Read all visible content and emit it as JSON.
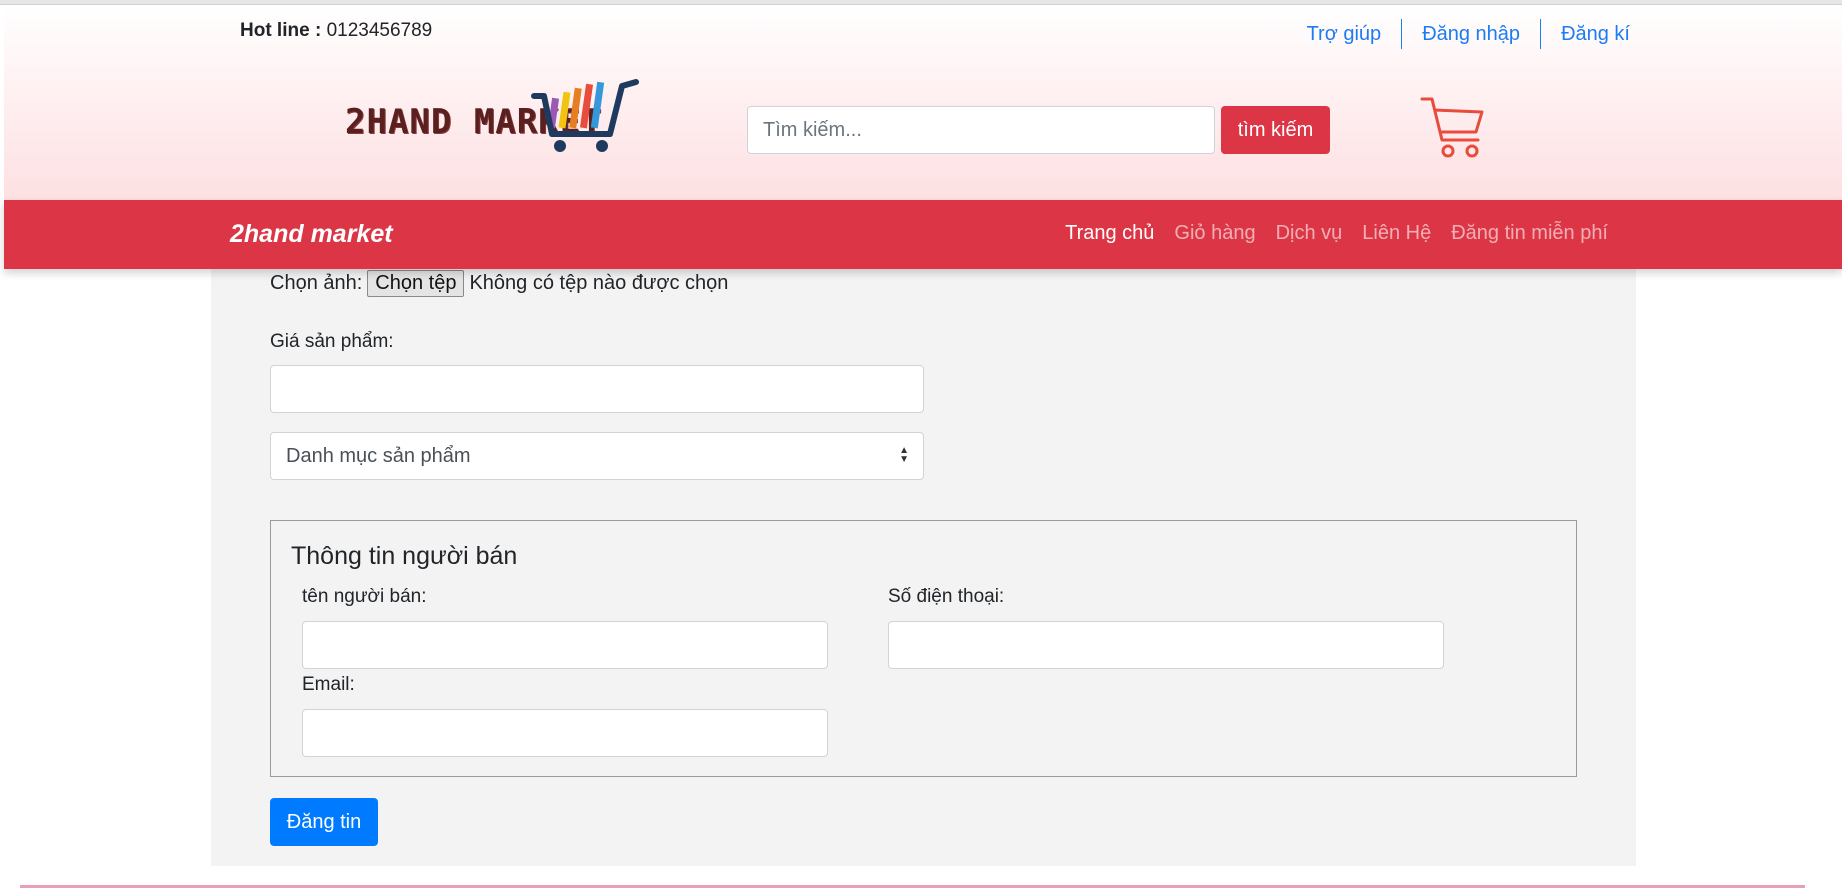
{
  "topbar": {
    "hotline_label": "Hot line :",
    "hotline_number": "0123456789",
    "links": [
      "Trợ giúp",
      "Đăng nhập",
      "Đăng kí"
    ]
  },
  "logo": {
    "text": "2HAND MARKET",
    "cart_bar_colors": [
      "#9b59b6",
      "#f1c40f",
      "#e67e22",
      "#e74c3c",
      "#3498db"
    ],
    "cart_color": "#1f3a5f"
  },
  "search": {
    "placeholder": "Tìm kiếm...",
    "button_label": "tìm kiếm"
  },
  "cart_icon_color": "#e74c3c",
  "navbar": {
    "brand": "2hand market",
    "items": [
      "Trang chủ",
      "Giỏ hàng",
      "Dịch vụ",
      "Liên Hệ",
      "Đăng tin miễn phí"
    ],
    "active_index": 0,
    "color": "#dc3545"
  },
  "form": {
    "image_label": "Chọn ảnh:",
    "file_button": "Chọn tệp",
    "file_status": "Không có tệp nào được chọn",
    "price_label": "Giá sản phẩm:",
    "price_value": "",
    "category_selected": "Danh mục sản phẩm",
    "seller": {
      "legend": "Thông tin người bán",
      "name_label": "tên người bán:",
      "phone_label": "Số điện thoại:",
      "email_label": "Email:"
    },
    "submit_label": "Đăng tin"
  }
}
